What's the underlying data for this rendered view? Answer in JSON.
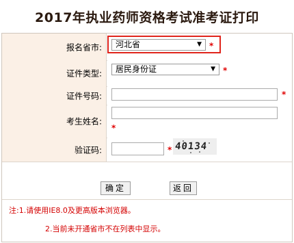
{
  "title": "2017年执业药师资格考试准考证打印",
  "form": {
    "province": {
      "label": "报名省市:",
      "value": "河北省"
    },
    "id_type": {
      "label": "证件类型:",
      "value": "居民身份证"
    },
    "id_number": {
      "label": "证件号码:",
      "value": ""
    },
    "name": {
      "label": "考生姓名:",
      "value": ""
    },
    "captcha": {
      "label": "验证码:",
      "value": "",
      "image_text": "40134"
    },
    "required_mark": "*"
  },
  "buttons": {
    "confirm": "确定",
    "back": "返回"
  },
  "notes": {
    "line1": "注:1.请使用IE8.0及更高版本浏览器。",
    "line2": "2.当前未开通省市不在列表中显示。"
  },
  "colors": {
    "required": "#e00000",
    "highlight_border": "#e0241b",
    "label_bg": "#fbf0e6",
    "note": "#d40000"
  }
}
